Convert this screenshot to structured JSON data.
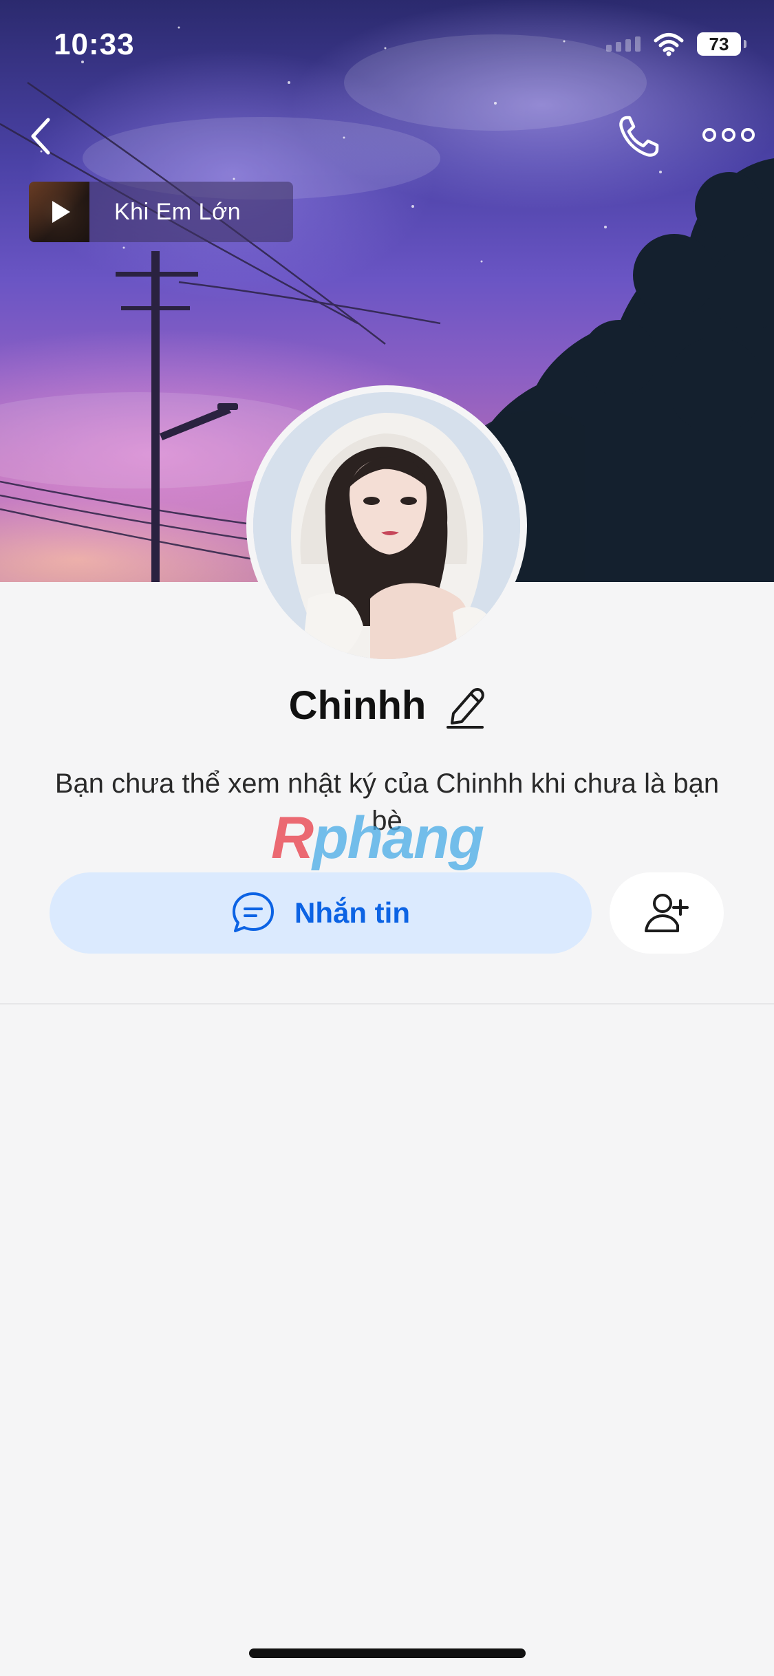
{
  "status_bar": {
    "time": "10:33",
    "battery": "73"
  },
  "cover": {
    "music": {
      "title": "Khi Em Lớn"
    }
  },
  "profile": {
    "name": "Chinhh",
    "notice": "Bạn chưa thể xem nhật ký của Chinhh khi chưa là bạn bè"
  },
  "actions": {
    "message_label": "Nhắn tin"
  },
  "watermark": {
    "part1": "R",
    "part2": "phang"
  },
  "icons": {
    "back": "chevron-left-icon",
    "call": "phone-icon",
    "more": "more-horizontal-icon",
    "play": "play-icon",
    "edit": "pencil-icon",
    "chat": "chat-bubble-icon",
    "add_friend": "user-plus-icon"
  },
  "colors": {
    "accent": "#0c63e4",
    "message_button_bg": "#dbeafe",
    "page_bg": "#f5f5f6"
  }
}
